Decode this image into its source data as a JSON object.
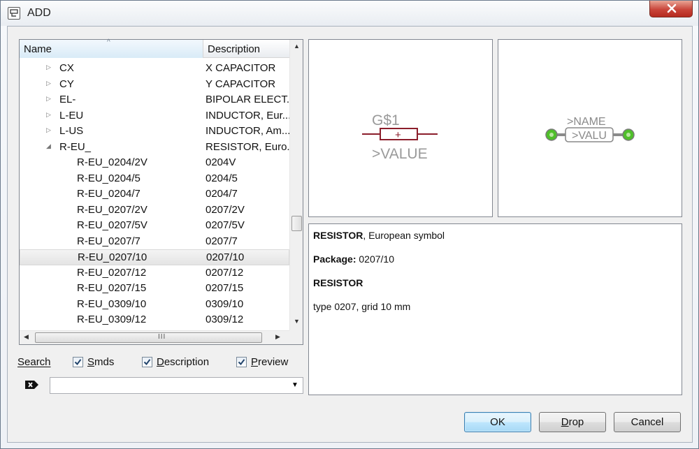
{
  "window": {
    "title": "ADD"
  },
  "tree": {
    "columns": {
      "name": "Name",
      "description": "Description"
    },
    "rows": [
      {
        "name": "CX",
        "description": "X CAPACITOR",
        "level": 0,
        "expander": "collapsed"
      },
      {
        "name": "CY",
        "description": "Y CAPACITOR",
        "level": 0,
        "expander": "collapsed"
      },
      {
        "name": "EL-",
        "description": "BIPOLAR ELECT...",
        "level": 0,
        "expander": "collapsed"
      },
      {
        "name": "L-EU",
        "description": "INDUCTOR, Eur...",
        "level": 0,
        "expander": "collapsed"
      },
      {
        "name": "L-US",
        "description": "INDUCTOR, Am...",
        "level": 0,
        "expander": "collapsed"
      },
      {
        "name": "R-EU_",
        "description": "RESISTOR, Euro...",
        "level": 0,
        "expander": "expanded"
      },
      {
        "name": "R-EU_0204/2V",
        "description": "0204V",
        "level": 1
      },
      {
        "name": "R-EU_0204/5",
        "description": "0204/5",
        "level": 1
      },
      {
        "name": "R-EU_0204/7",
        "description": "0204/7",
        "level": 1
      },
      {
        "name": "R-EU_0207/2V",
        "description": "0207/2V",
        "level": 1
      },
      {
        "name": "R-EU_0207/5V",
        "description": "0207/5V",
        "level": 1
      },
      {
        "name": "R-EU_0207/7",
        "description": "0207/7",
        "level": 1
      },
      {
        "name": "R-EU_0207/10",
        "description": "0207/10",
        "level": 1,
        "selected": true
      },
      {
        "name": "R-EU_0207/12",
        "description": "0207/12",
        "level": 1
      },
      {
        "name": "R-EU_0207/15",
        "description": "0207/15",
        "level": 1
      },
      {
        "name": "R-EU_0309/10",
        "description": "0309/10",
        "level": 1
      },
      {
        "name": "R-EU_0309/12",
        "description": "0309/12",
        "level": 1
      }
    ],
    "scroll_grip": "III"
  },
  "search": {
    "label": "Search",
    "options": [
      {
        "label": "Smds",
        "checked": true
      },
      {
        "label": "Description",
        "checked": true
      },
      {
        "label": "Preview",
        "checked": true
      }
    ],
    "value": ""
  },
  "symbol_preview": {
    "name_text": "G$1",
    "value_text": ">VALUE",
    "plus": "+"
  },
  "package_preview": {
    "name_text": ">NAME",
    "value_text": ">VALU"
  },
  "info": {
    "line1_bold": "RESISTOR",
    "line1_rest": ", European symbol",
    "line2_bold": "Package:",
    "line2_rest": " 0207/10",
    "line3_bold": "RESISTOR",
    "line4": "type 0207, grid 10 mm"
  },
  "buttons": {
    "ok": "OK",
    "drop": "Drop",
    "cancel": "Cancel"
  },
  "colors": {
    "symbol_body": "#8b1e2b",
    "symbol_text": "#9a9a9a",
    "pad_green": "#4fbf2a",
    "package_outline": "#8a8a8a"
  }
}
